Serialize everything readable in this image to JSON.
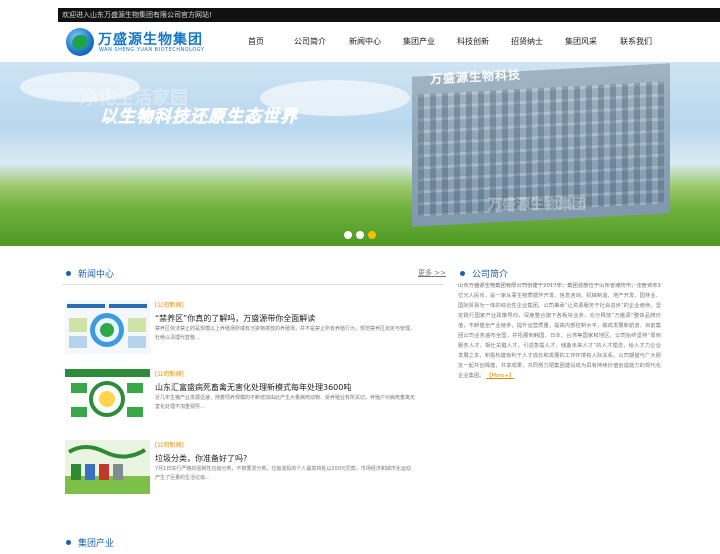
{
  "topbar": {
    "welcome": "欢迎进入山东万盛源生物集团有限公司官方网站!"
  },
  "logo": {
    "cn": "万盛源生物集团",
    "en": "WAN SHENG YUAN BIOTECHNOLOGY"
  },
  "nav": {
    "items": [
      "首页",
      "公司简介",
      "新闻中心",
      "集团产业",
      "科技创新",
      "招贤纳士",
      "集团风采",
      "联系我们"
    ]
  },
  "banner": {
    "slogan": "以生物科技还原生态世界",
    "ghost_text": "净化生活家园",
    "building_sign": "万盛源生物科技",
    "slides": 3,
    "active_slide": 3
  },
  "news": {
    "title": "新闻中心",
    "more": "更多 >>",
    "items": [
      {
        "category": "[公司新闻]",
        "title": "“禁养区”你真的了解吗，万盛源带你全面解读",
        "desc": "禁养区依法禁止的是规模以上养殖场所或有污染物排放的养殖场，并不是禁止所有养殖行为，规范禁养区划定与管理，杜绝以清理代替整..."
      },
      {
        "category": "[公司新闻]",
        "title": "山东汇富盛病死畜禽无害化处理新模式每年处理3600吨",
        "desc": "近几年生猪产业发展迅速，随着饲养规模的不断增加由此产生大量病死动物、受养殖业有所关切，养殖户对病死畜禽无害化处理不加重视导..."
      },
      {
        "category": "[公司新闻]",
        "title": "垃圾分类，你准备好了吗?",
        "desc": "7月1日实行严格的强制性垃圾分类，不按要求分类，垃圾混投的个人最高将处以200元罚款，市场经济和城市化运动产生了巨量的生活垃圾..."
      }
    ]
  },
  "about": {
    "title": "公司简介",
    "text": "山东万盛源生物集团有限公司创建于2017年，集团总部位于山东省潍坊市，注册资本1亿元人民币，是一家从事生物质循环开发、信息咨询、机械制造、地产开发、园林业、国际贸易为一体的综合性企业集团。公司秉承“让资源服务于社会进步”的企业使命，坚定践行国家产业政策导向，深度整合旗下各板块业务，充分释放“万盛源”整体品牌价值，不断健全产业链条，提升运营质量，提高内部控制水平，做成发展新航道，目前集团公司业务遍布全国，并拓展到韩国、日本、台湾等国家和地区。公司始终坚持“周到服务人才，相仕关键人才，引进急需人才，储备未来人才”的人才理念，给人才力企业发展之本，积极构建有利于人才成长和发展的工作环境和人际关系。公司期望与广大朋友一起共创辉煌，共享成果，共同努力把集团建设成为具有持续价值创造能力的现代化企业集团。",
    "more": "【More+】"
  },
  "section3": {
    "title": "集团产业"
  },
  "colors": {
    "brand_blue": "#1a5fae",
    "accent_orange": "#e58a00",
    "topbar": "#111111"
  }
}
